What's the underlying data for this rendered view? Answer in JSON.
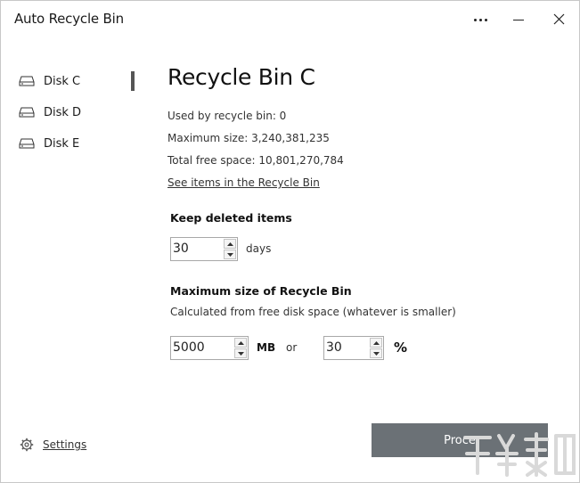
{
  "window": {
    "title": "Auto Recycle Bin",
    "more_icon": "more-horizontal-icon",
    "minimize_icon": "minimize-icon",
    "close_icon": "close-icon"
  },
  "sidebar": {
    "items": [
      {
        "label": "Disk C",
        "icon": "drive-icon",
        "selected": true
      },
      {
        "label": "Disk D",
        "icon": "drive-icon",
        "selected": false
      },
      {
        "label": "Disk E",
        "icon": "drive-icon",
        "selected": false
      }
    ],
    "settings_label": "Settings",
    "settings_icon": "gear-icon"
  },
  "main": {
    "title": "Recycle Bin C",
    "used": "Used by recycle bin: 0",
    "max_size": "Maximum size: 3,240,381,235",
    "free_space": "Total free space: 10,801,270,784",
    "see_items_link": "See items in the Recycle Bin",
    "keep_label": "Keep deleted items",
    "keep_value": "30",
    "keep_unit": "days",
    "max_label": "Maximum size of Recycle Bin",
    "max_sub": "Calculated from free disk space (whatever is smaller)",
    "mb_value": "5000",
    "mb_unit": "MB",
    "or_text": "or",
    "pct_value": "30",
    "pct_unit": "%",
    "proceed_label": "Proce"
  },
  "colors": {
    "proceed_bg": "#6b7176",
    "selection_bar": "#555555",
    "watermark": "#d9d9d9"
  }
}
